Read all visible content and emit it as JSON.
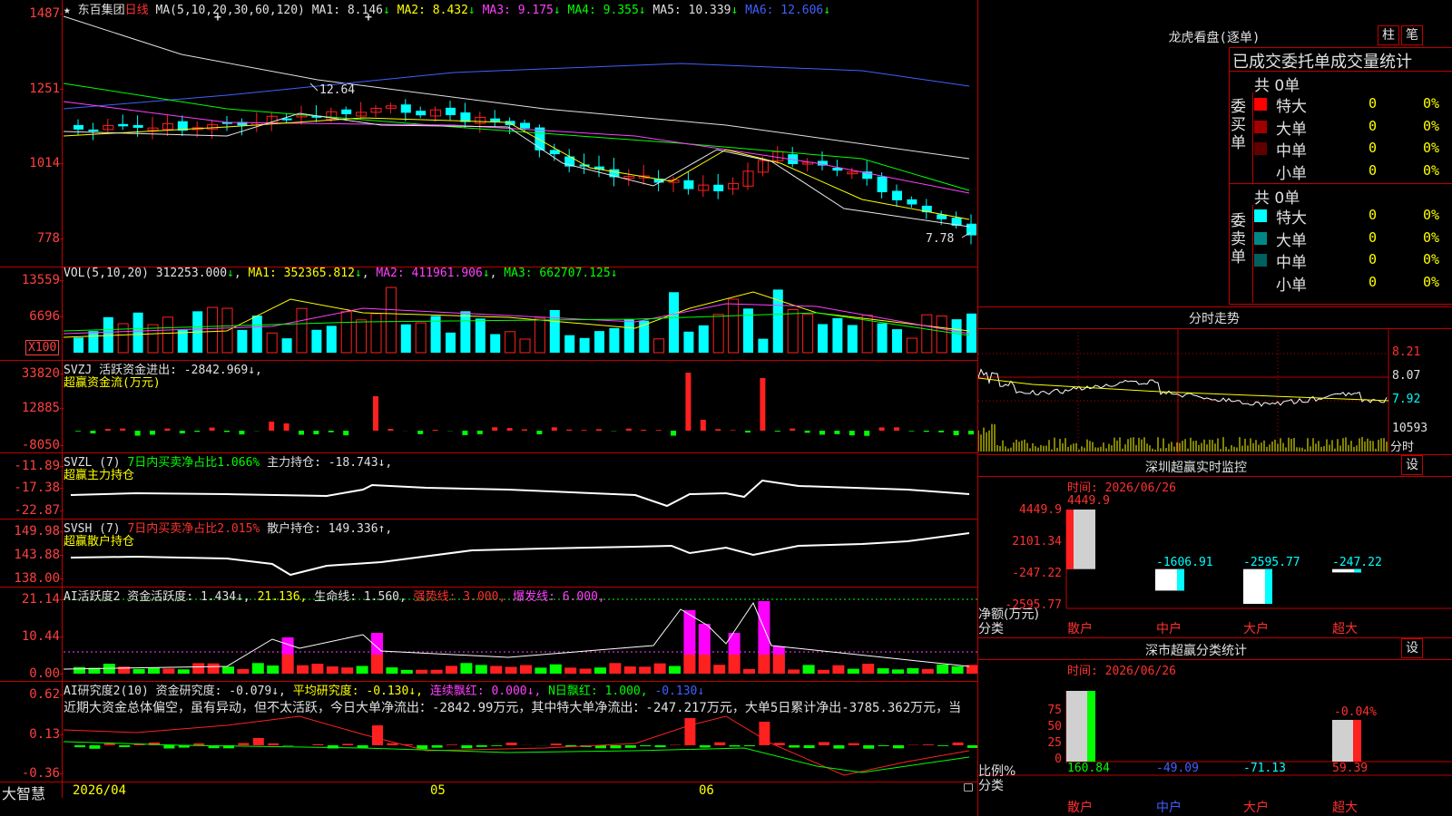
{
  "main": {
    "star": "★",
    "stock_name": "东百集团",
    "period": "日线",
    "ma_header": "MA(5,10,20,30,60,120)",
    "ma": [
      {
        "label": "MA1:",
        "value": "8.146",
        "arrow": "↓",
        "color": "#e0e0e0"
      },
      {
        "label": "MA2:",
        "value": "8.432",
        "arrow": "↓",
        "color": "#ffff00"
      },
      {
        "label": "MA3:",
        "value": "9.175",
        "arrow": "↓",
        "color": "#ff40ff"
      },
      {
        "label": "MA4:",
        "value": "9.355",
        "arrow": "↓",
        "color": "#00ff00"
      },
      {
        "label": "MA5:",
        "value": "10.339",
        "arrow": "↓",
        "color": "#e0e0e0"
      },
      {
        "label": "MA6:",
        "value": "12.606",
        "arrow": "↓",
        "color": "#4060ff"
      }
    ],
    "y_ticks": [
      "1487",
      "1251",
      "1014",
      "778"
    ],
    "high_label": "12.64",
    "low_label": "7.78",
    "plus_marks": [
      "+",
      "+"
    ]
  },
  "vol": {
    "header_name": "VOL(5,10,20)",
    "value": "312253.000",
    "arrow": "↓",
    "ma1": "MA1: 352365.812",
    "ma2": "MA2: 411961.906",
    "ma3": "MA3: 662707.125",
    "y_ticks": [
      "13559",
      "6696"
    ],
    "unit_box": "X100"
  },
  "svzj": {
    "line1": "SVZJ  活跃资金进出: -2842.969↓,",
    "line2": "超赢资金流(万元)",
    "y_ticks": [
      "33820",
      "12885",
      "-8050"
    ]
  },
  "svzl": {
    "name": "SVZL (7)",
    "ratio": "7日内买卖净占比1.066%",
    "hold": "主力持仓: -18.743↓,",
    "line2": "超赢主力持仓",
    "y_ticks": [
      "-11.89",
      "-17.38",
      "-22.87"
    ]
  },
  "svsh": {
    "name": "SVSH (7)",
    "ratio": "7日内买卖净占比2.015%",
    "hold": "散户持仓: 149.336↑,",
    "line2": "超赢散户持仓",
    "y_ticks": [
      "149.98",
      "143.88",
      "138.00"
    ]
  },
  "ai2": {
    "t1": "AI活跃度2 资金活跃度: 1.434↓,",
    "t2": "21.136,",
    "t3": "生命线: 1.560,",
    "t4": "强势线: 3.000,",
    "t5": "爆发线: 6.000,",
    "y_ticks": [
      "21.14",
      "10.44",
      "0.00"
    ]
  },
  "ai_research": {
    "t1": "AI研究度2(10) 资金研究度: -0.079↓,",
    "t2": "平均研究度: -0.130↓,",
    "t3": "连续飘红: 0.000↓,",
    "t4": "N日飘红: 1.000,",
    "t5": "-0.130↓",
    "comment": "近期大资金总体偏空，虽有异动，但不太活跃，今日大单净流出：-2842.99万元，其中特大单净流出：-247.217万元，大单5日累计净出-3785.362万元，当",
    "y_ticks": [
      "0.62",
      "0.13",
      "-0.36"
    ]
  },
  "xaxis": {
    "brand": "大智慧",
    "dates": [
      "2026/04",
      "05",
      "06"
    ]
  },
  "right": {
    "dragon": {
      "title": "龙虎看盘(逐单)",
      "btn1": "柱",
      "btn2": "笔",
      "subtitle": "已成交委托单成交量统计",
      "buy_label": "委买单",
      "sell_label": "委卖单",
      "buy_total": "共 0单",
      "sell_total": "共 0单",
      "buy_rows": [
        {
          "name": "特大",
          "count": "0",
          "pct": "0%",
          "color": "#ff0000"
        },
        {
          "name": "大单",
          "count": "0",
          "pct": "0%",
          "color": "#a00000"
        },
        {
          "name": "中单",
          "count": "0",
          "pct": "0%",
          "color": "#600000"
        },
        {
          "name": "小单",
          "count": "0",
          "pct": "0%",
          "color": "#000000"
        }
      ],
      "sell_rows": [
        {
          "name": "特大",
          "count": "0",
          "pct": "0%",
          "color": "#00ffff"
        },
        {
          "name": "大单",
          "count": "0",
          "pct": "0%",
          "color": "#008888"
        },
        {
          "name": "中单",
          "count": "0",
          "pct": "0%",
          "color": "#006060"
        },
        {
          "name": "小单",
          "count": "0",
          "pct": "0%",
          "color": "#000000"
        }
      ]
    },
    "intraday": {
      "title": "分时走势",
      "prices": [
        "8.21",
        "8.07",
        "7.92"
      ],
      "vol_label": "10593",
      "tab": "分时"
    },
    "sz_monitor": {
      "title": "深圳超赢实时监控",
      "settings": "设",
      "time": "时间: 2026/06/26",
      "y_ticks": [
        "4449.9",
        "2101.34",
        "-247.22",
        "-2595.77"
      ],
      "y_unit": "净额(万元)",
      "x_unit": "分类",
      "values": [
        {
          "cat": "散户",
          "value": "4449.9",
          "num": 4449.9
        },
        {
          "cat": "中户",
          "value": "-1606.91",
          "num": -1606.91
        },
        {
          "cat": "大户",
          "value": "-2595.77",
          "num": -2595.77
        },
        {
          "cat": "超大",
          "value": "-247.22",
          "num": -247.22
        }
      ]
    },
    "sz_stats": {
      "title": "深市超赢分类统计",
      "settings": "设",
      "time": "时间: 2026/06/26",
      "y_ticks": [
        "75",
        "50",
        "25",
        "0"
      ],
      "y_unit": "比例%",
      "x_unit": "分类",
      "cats": [
        "散户",
        "中户",
        "大户",
        "超大"
      ],
      "values": [
        "160.84",
        "-49.09",
        "-71.13",
        "59.39"
      ],
      "note": "-0.04%"
    }
  },
  "colors": {
    "border": "#c00000",
    "up": "#ff0000",
    "down": "#00ffff",
    "axis_text": "#ff4040"
  }
}
